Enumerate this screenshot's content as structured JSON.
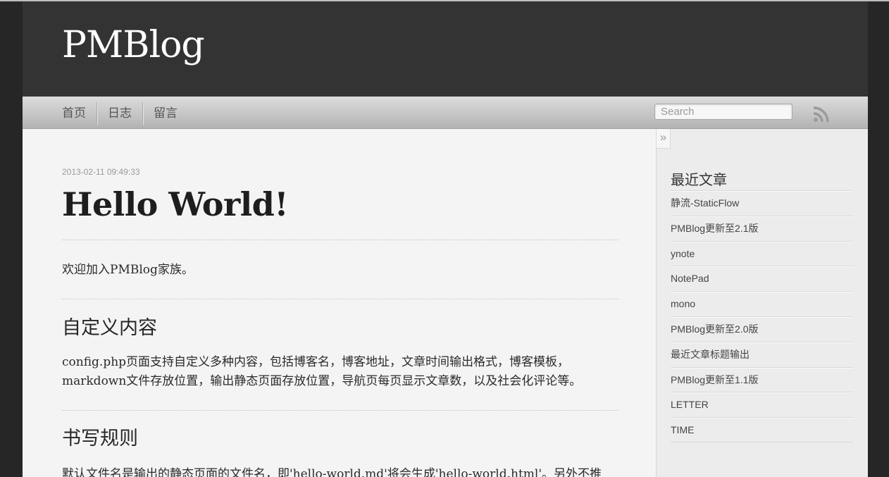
{
  "site": {
    "title": "PMBlog"
  },
  "nav": {
    "items": [
      "首页",
      "日志",
      "留言"
    ]
  },
  "search": {
    "placeholder": "Search"
  },
  "post": {
    "date": "2013-02-11 09:49:33",
    "title": "Hello World!",
    "intro": "欢迎加入PMBlog家族。",
    "sections": [
      {
        "heading": "自定义内容",
        "body": "config.php页面支持自定义多种内容，包括博客名，博客地址，文章时间输出格式，博客模板，markdown文件存放位置，输出静态页面存放位置，导航页每页显示文章数，以及社会化评论等。"
      },
      {
        "heading": "书写规则",
        "body": "默认文件名是输出的静态页面的文件名，即'hello-world.md'将会生成'hello-world.html'。另外不推"
      }
    ]
  },
  "sidebar": {
    "toggle_glyph": "»",
    "recent_title": "最近文章",
    "recent_posts": [
      "静流-StaticFlow",
      "PMBlog更新至2.1版",
      "ynote",
      "NotePad",
      "mono",
      "PMBlog更新至2.0版",
      "最近文章标题输出",
      "PMBlog更新至1.1版",
      "LETTER",
      "TIME"
    ]
  },
  "icons": {
    "feed": "rss-icon"
  },
  "colors": {
    "header_bg": "#333333",
    "page_bg": "#262626",
    "content_bg": "#f4f4f4"
  }
}
